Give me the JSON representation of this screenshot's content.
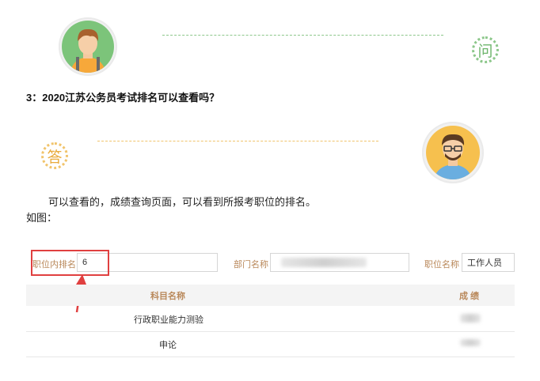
{
  "question": {
    "icon": "问",
    "text": "3：2020江苏公务员考试排名可以查看吗？"
  },
  "answer": {
    "icon": "答",
    "line1": "可以查看的，成绩查询页面，可以看到所报考职位的排名。",
    "line2": "如图："
  },
  "screenshot": {
    "rank_label": "职位内排名",
    "rank_value": "6",
    "dept_label": "部门名称",
    "position_label": "职位名称",
    "position_value": "工作人员",
    "col_subject": "科目名称",
    "col_score": "成 绩",
    "rows": [
      {
        "subject": "行政职业能力测验"
      },
      {
        "subject": "申论"
      }
    ]
  },
  "colors": {
    "green_accent": "#8cc78a",
    "orange_accent": "#f1c46c",
    "highlight_red": "#e04040",
    "label_brown": "#b9885a"
  }
}
